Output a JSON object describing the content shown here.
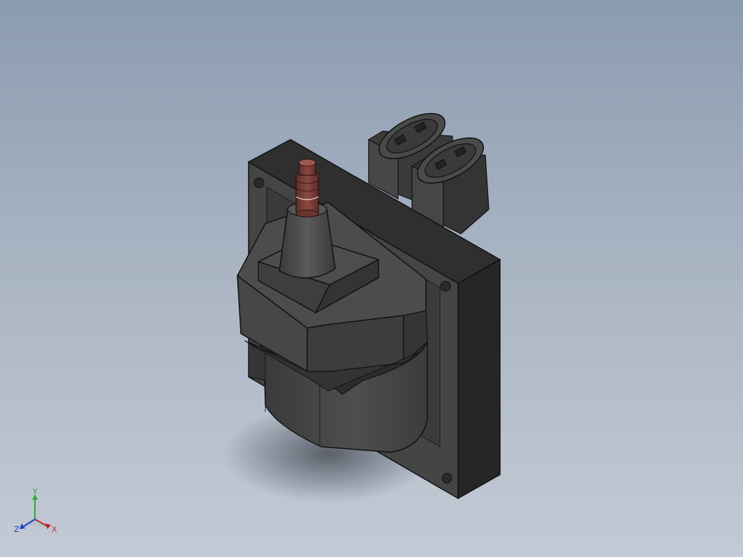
{
  "viewport": {
    "background_top": "#8b9bb0",
    "background_bottom": "#c3cad5"
  },
  "triad": {
    "x_label": "X",
    "y_label": "Y",
    "z_label": "Z",
    "x_color": "#c0262d",
    "y_color": "#2fa83c",
    "z_color": "#1f3fc4"
  },
  "model": {
    "body_color": "#3e3e3e",
    "terminal_color": "#7a3b35"
  }
}
